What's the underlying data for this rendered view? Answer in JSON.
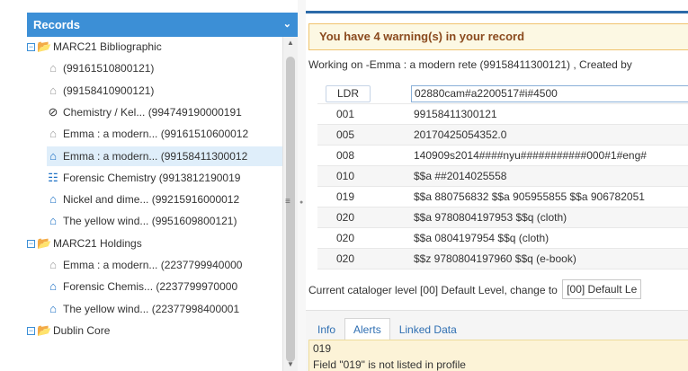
{
  "sidebar": {
    "header": "Records",
    "tree": [
      {
        "kind": "group",
        "label": "MARC21 Bibliographic"
      },
      {
        "kind": "item",
        "icon": "home-gray",
        "label": "(99161510800121)"
      },
      {
        "kind": "item",
        "icon": "home-gray",
        "label": "(99158410900121)"
      },
      {
        "kind": "item",
        "icon": "ban",
        "label": "Chemistry / Kel... (994749190000191"
      },
      {
        "kind": "item",
        "icon": "home-gray",
        "label": "Emma : a modern... (99161510600012"
      },
      {
        "kind": "item",
        "icon": "home-blue",
        "label": "Emma : a modern... (99158411300012",
        "selected": true
      },
      {
        "kind": "item",
        "icon": "sitemap",
        "label": "Forensic Chemistry (9913812190019"
      },
      {
        "kind": "item",
        "icon": "home-blue",
        "label": "Nickel and dime... (99215916000012"
      },
      {
        "kind": "item",
        "icon": "home-blue",
        "label": "The yellow wind... (9951609800121)"
      },
      {
        "kind": "group",
        "label": "MARC21 Holdings"
      },
      {
        "kind": "item",
        "icon": "home-gray",
        "label": "Emma : a modern... (2237799940000"
      },
      {
        "kind": "item",
        "icon": "home-blue",
        "label": "Forensic Chemis... (2237799970000"
      },
      {
        "kind": "item",
        "icon": "home-blue",
        "label": "The yellow wind... (22377998400001"
      },
      {
        "kind": "group",
        "label": "Dublin Core"
      }
    ]
  },
  "editor": {
    "warning": "You have 4 warning(s) in your record",
    "working_on": "Working on -Emma : a modern rete (99158411300121) , Created by",
    "fields": [
      {
        "tag": "LDR",
        "value": "02880cam#a2200517#i#4500"
      },
      {
        "tag": "001",
        "value": "99158411300121"
      },
      {
        "tag": "005",
        "value": "20170425054352.0"
      },
      {
        "tag": "008",
        "value": "140909s2014####nyu###########000#1#eng#"
      },
      {
        "tag": "010",
        "value": "$$a ##2014025558"
      },
      {
        "tag": "019",
        "value": "$$a 880756832 $$a 905955855 $$a 906782051"
      },
      {
        "tag": "020",
        "value": "$$a 9780804197953 $$q (cloth)"
      },
      {
        "tag": "020",
        "value": "$$a 0804197954 $$q (cloth)"
      },
      {
        "tag": "020",
        "value": "$$z 9780804197960 $$q (e-book)"
      }
    ],
    "cataloger_text": "Current cataloger level [00] Default Level, change to",
    "cataloger_select": "[00] Default Le"
  },
  "bottom": {
    "tabs": [
      "Info",
      "Alerts",
      "Linked Data"
    ],
    "active_tab": "Alerts",
    "alert_code": "019",
    "alert_message": "Field \"019\" is not listed in profile"
  },
  "colors": {
    "header_bg": "#3c8fd6",
    "warning_bg": "#fcf8e3",
    "warning_text": "#8a4a1e",
    "selected_row": "#dfeefa",
    "alert_bg": "#fcf3d7"
  }
}
